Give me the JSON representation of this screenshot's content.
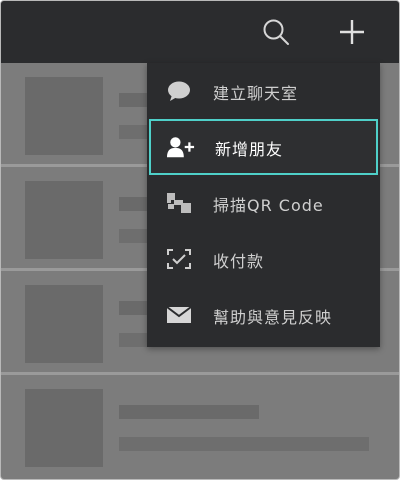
{
  "topbar": {
    "search_icon": "search-icon",
    "add_icon": "plus-icon"
  },
  "menu": {
    "items": [
      {
        "label": "建立聊天室",
        "icon": "chat-bubble-icon"
      },
      {
        "label": "新增朋友",
        "icon": "add-person-icon"
      },
      {
        "label": "掃描QR Code",
        "icon": "qr-scan-icon"
      },
      {
        "label": "收付款",
        "icon": "payment-scan-icon"
      },
      {
        "label": "幫助與意見反映",
        "icon": "mail-icon"
      }
    ],
    "selected_index": 1
  },
  "colors": {
    "topbar": "#2b2c2e",
    "overlay": "#7c7c7c",
    "highlight_border": "#4fd0c9"
  }
}
